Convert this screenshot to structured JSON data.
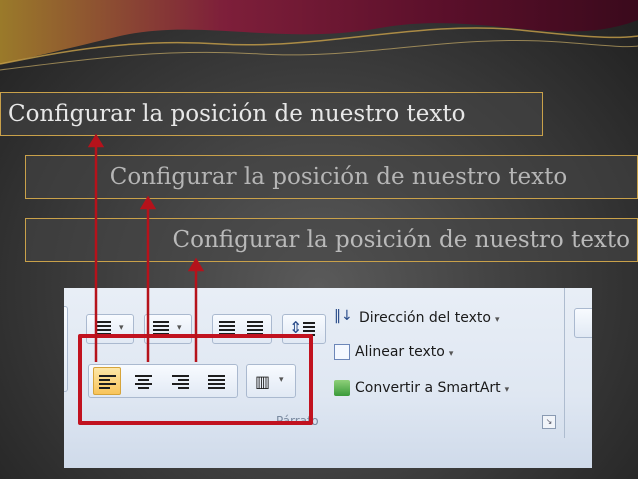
{
  "banners": [
    {
      "text": "Configurar la posición de nuestro texto",
      "align": "left"
    },
    {
      "text": "Configurar la posición de nuestro texto",
      "align": "center"
    },
    {
      "text": "Configurar la posición de nuestro texto",
      "align": "right"
    }
  ],
  "ribbon": {
    "commands": [
      {
        "label": "Dirección del texto",
        "icon": "text-direction-icon"
      },
      {
        "label": "Alinear texto",
        "icon": "align-text-icon"
      },
      {
        "label": "Convertir a SmartArt",
        "icon": "smartart-icon"
      }
    ],
    "alignment_buttons": [
      {
        "icon": "align-left-icon",
        "selected": true
      },
      {
        "icon": "align-center-icon",
        "selected": false
      },
      {
        "icon": "align-right-icon",
        "selected": false
      },
      {
        "icon": "justify-icon",
        "selected": false
      }
    ],
    "group_label": "Párrafo"
  },
  "colors": {
    "highlight_box": "#c1121f",
    "arrow": "#b5121b",
    "banner_border": "#c9a14a",
    "header_wave": "#8a1f3a"
  }
}
